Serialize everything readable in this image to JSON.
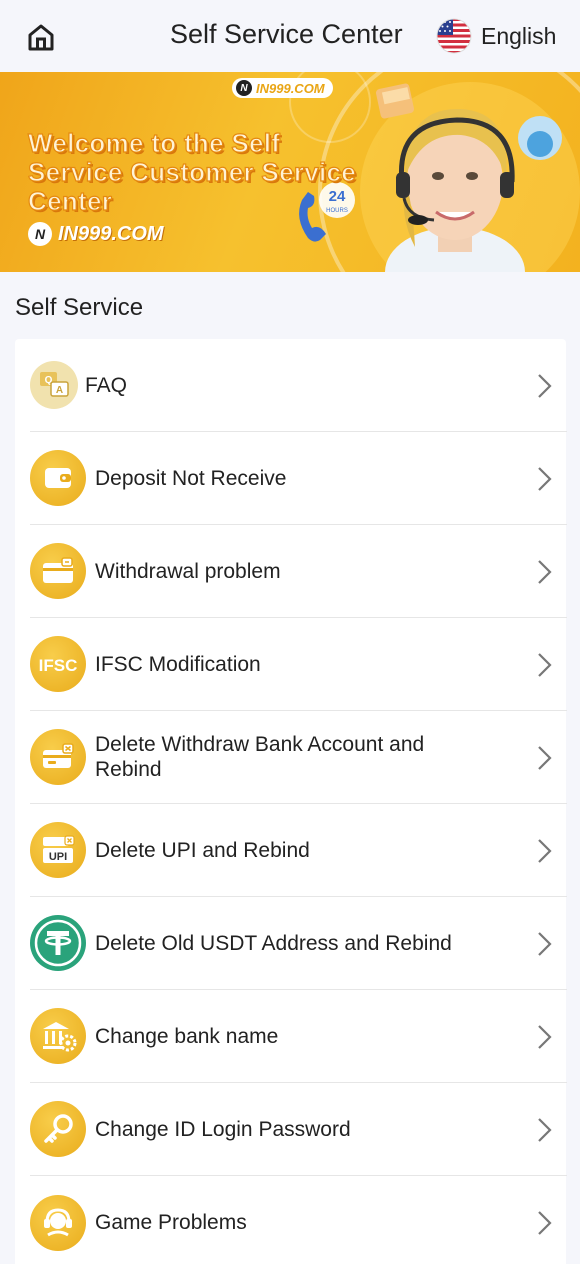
{
  "header": {
    "title": "Self Service Center",
    "language": "English"
  },
  "banner": {
    "brand": "IN999.COM",
    "headline": "Welcome to the Self Service Customer Service Center",
    "brand_bottom": "IN999.COM",
    "badge_24": "24",
    "badge_hours": "HOURS"
  },
  "section": {
    "title": "Self Service"
  },
  "items": [
    {
      "label": "FAQ",
      "icon": "faq-icon"
    },
    {
      "label": "Deposit Not Receive",
      "icon": "wallet-icon"
    },
    {
      "label": "Withdrawal problem",
      "icon": "withdrawal-card-icon"
    },
    {
      "label": "IFSC Modification",
      "icon": "ifsc-icon"
    },
    {
      "label": "Delete Withdraw Bank Account and Rebind",
      "icon": "delete-card-icon"
    },
    {
      "label": "Delete UPI and Rebind",
      "icon": "upi-icon"
    },
    {
      "label": "Delete Old USDT Address and Rebind",
      "icon": "usdt-icon"
    },
    {
      "label": "Change bank name",
      "icon": "bank-settings-icon"
    },
    {
      "label": "Change ID Login Password",
      "icon": "key-icon"
    },
    {
      "label": "Game Problems",
      "icon": "headset-icon"
    }
  ],
  "colors": {
    "accent_gold": "#e9ac1c",
    "usdt_green": "#2aa37b",
    "background": "#f5f6fb"
  }
}
